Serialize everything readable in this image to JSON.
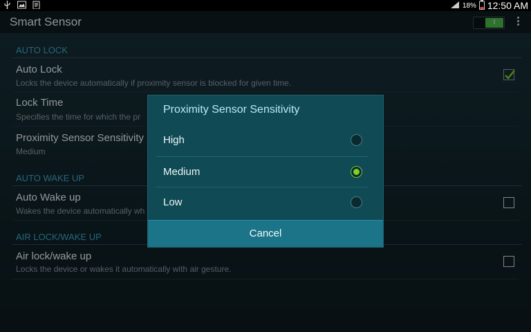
{
  "status_bar": {
    "battery_percent": "18%",
    "time": "12:50 AM",
    "left_icons": [
      "usb-icon",
      "image-icon",
      "clipboard-icon"
    ]
  },
  "app_bar": {
    "title": "Smart Sensor",
    "toggle_label": "I",
    "toggle_on": true
  },
  "sections": [
    {
      "header": "AUTO LOCK",
      "prefs": [
        {
          "title": "Auto Lock",
          "subtitle": "Locks the device automatically if proximity sensor is blocked for given time.",
          "checked": true
        },
        {
          "title": "Lock Time",
          "subtitle": "Specifies the time for which the pr"
        },
        {
          "title": "Proximity Sensor Sensitivity",
          "subtitle": "Medium"
        }
      ]
    },
    {
      "header": "AUTO WAKE UP",
      "prefs": [
        {
          "title": "Auto Wake up",
          "subtitle": "Wakes the device automatically wh",
          "checked": false
        }
      ]
    },
    {
      "header": "AIR LOCK/WAKE UP",
      "prefs": [
        {
          "title": "Air lock/wake up",
          "subtitle": "Locks the device or wakes it automatically with air gesture.",
          "checked": false
        }
      ]
    }
  ],
  "dialog": {
    "title": "Proximity Sensor Sensitivity",
    "options": [
      {
        "label": "High",
        "selected": false
      },
      {
        "label": "Medium",
        "selected": true
      },
      {
        "label": "Low",
        "selected": false
      }
    ],
    "cancel_label": "Cancel"
  },
  "colors": {
    "accent_section": "#3aa6c4",
    "dialog_bg": "#0f4a55",
    "cancel_bg": "#1b7488",
    "radio_selected": "#7ed321",
    "toggle_on": "#4db84d"
  }
}
